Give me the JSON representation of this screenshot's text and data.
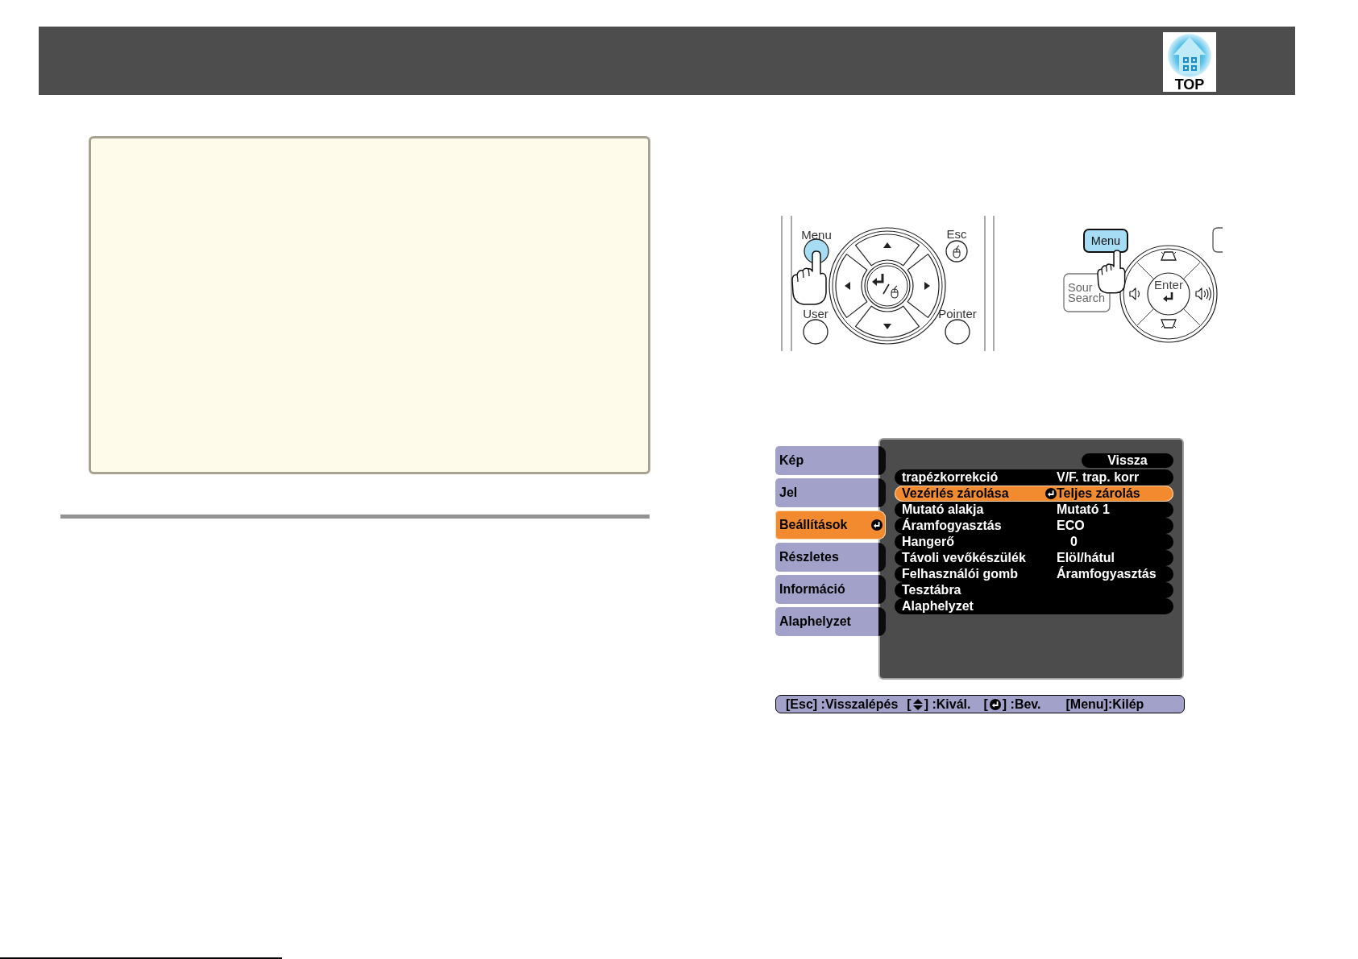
{
  "header": {
    "logo_label": "TOP"
  },
  "remote": {
    "buttons": [
      {
        "label": "Menu",
        "pressed": true
      },
      {
        "label": "Esc",
        "pressed": false
      },
      {
        "label": "User",
        "pressed": false
      },
      {
        "label": "Pointer",
        "pressed": false
      }
    ]
  },
  "control_panel": {
    "buttons": [
      {
        "lines": [
          "Menu"
        ],
        "pressed": true
      },
      {
        "lines": [
          "Sour",
          "Search"
        ],
        "pressed": false
      }
    ],
    "enter_label": "Enter"
  },
  "osd_menu": {
    "tabs": [
      {
        "label": "Kép",
        "selected": false
      },
      {
        "label": "Jel",
        "selected": false
      },
      {
        "label": "Beállítások",
        "selected": true
      },
      {
        "label": "Részletes",
        "selected": false
      },
      {
        "label": "Információ",
        "selected": false
      },
      {
        "label": "Alaphelyzet",
        "selected": false
      }
    ],
    "back_button": "Vissza",
    "rows": [
      {
        "kind": "option",
        "label": "trapézkorrekció",
        "value": "V/F. trap. korr",
        "selected": false
      },
      {
        "kind": "option",
        "label": "Vezérlés zárolása",
        "value": "Teljes zárolás",
        "selected": true
      },
      {
        "kind": "option",
        "label": "Mutató alakja",
        "value": "Mutató 1",
        "selected": false
      },
      {
        "kind": "option",
        "label": "Áramfogyasztás",
        "value": "ECO",
        "selected": false
      },
      {
        "kind": "number",
        "label": "Hangerő",
        "value": "0",
        "selected": false
      },
      {
        "kind": "option",
        "label": "Távoli vevőkészülék",
        "value": "Elöl/hátul",
        "selected": false
      },
      {
        "kind": "option",
        "label": "Felhasználói gomb",
        "value": "Áramfogyasztás",
        "selected": false
      },
      {
        "kind": "action",
        "label": "Tesztábra",
        "selected": false
      },
      {
        "kind": "action",
        "label": "Alaphelyzet",
        "selected": false
      }
    ],
    "help_bar": [
      {
        "kind": "text",
        "label": "[Esc] :Visszalépés"
      },
      {
        "kind": "updown",
        "before": "[",
        "after": "] :Kivál."
      },
      {
        "kind": "enter",
        "before": "[",
        "after": "] :Bev."
      },
      {
        "kind": "text",
        "label": "[Menu]:Kilép"
      }
    ]
  }
}
